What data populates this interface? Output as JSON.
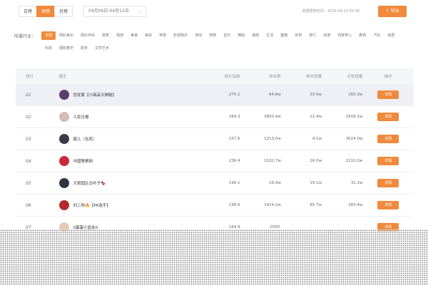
{
  "toolbar": {
    "periods": [
      "日榜",
      "周榜",
      "月榜"
    ],
    "active_period": 1,
    "date_range": "04月06日-04月12日",
    "update_time": "数据更新时间：2020-04-13 05:56",
    "export_label": "导出",
    "export_icon": "export-icon"
  },
  "industry": {
    "label": "所属行业：",
    "tags": [
      "全部",
      "网红美女",
      "网红帅哥",
      "搞笑",
      "情感",
      "美食",
      "美妆",
      "穿搭",
      "影视娱乐",
      "游戏",
      "宠物",
      "音乐",
      "舞蹈",
      "萌娃",
      "生活",
      "健康",
      "体育",
      "旅行",
      "动漫",
      "母婴育儿",
      "教育",
      "汽车",
      "家居",
      "科技",
      "摄影教学",
      "政务",
      "文学艺术"
    ],
    "active_tag": 0
  },
  "table": {
    "headers": [
      "排行",
      "播主",
      "成长指数",
      "粉丝数",
      "粉丝增量",
      "点赞增量",
      "操作"
    ],
    "detail_label": "详情",
    "rows": [
      {
        "rank": "01",
        "name": "优优家【小商品大揭秘】",
        "growth": "270.1",
        "fans": "64.8w",
        "fans_inc": "33.9w",
        "likes_inc": "160.3w",
        "avatar_color": "#5a3c6e"
      },
      {
        "rank": "02",
        "name": "人民日报",
        "growth": "269.3",
        "fans": "3800.4w",
        "fans_inc": "22.4w",
        "likes_inc": "2509.2w",
        "avatar_color": "#d9b9b9"
      },
      {
        "rank": "03",
        "name": "狐儿（吉风）",
        "growth": "237.6",
        "fans": "1213.0w",
        "fans_inc": "4.1w",
        "likes_inc": "3024.0w",
        "avatar_color": "#3b3b48"
      },
      {
        "rank": "04",
        "name": "中国警察网",
        "growth": "236.4",
        "fans": "1102.7w",
        "fans_inc": "26.0w",
        "likes_inc": "2110.2w",
        "avatar_color": "#c9283a"
      },
      {
        "rank": "05",
        "name": "大和园区😊叶子🍫",
        "growth": "199.1",
        "fans": "16.9w",
        "fans_inc": "19.1w",
        "likes_inc": "31.2w",
        "avatar_color": "#2f3540"
      },
      {
        "rank": "06",
        "name": "刘二狗🔥【PK选手】",
        "growth": "196.6",
        "fans": "1414.2w",
        "fans_inc": "85.7w",
        "likes_inc": "283.4w",
        "avatar_color": "#b52a2a"
      },
      {
        "rank": "07",
        "name": "0蛋蛋小盆友0",
        "growth": "164.9",
        "fans": "1050.",
        "fans_inc": "",
        "likes_inc": "",
        "avatar_color": "#e7c9b8"
      }
    ]
  }
}
